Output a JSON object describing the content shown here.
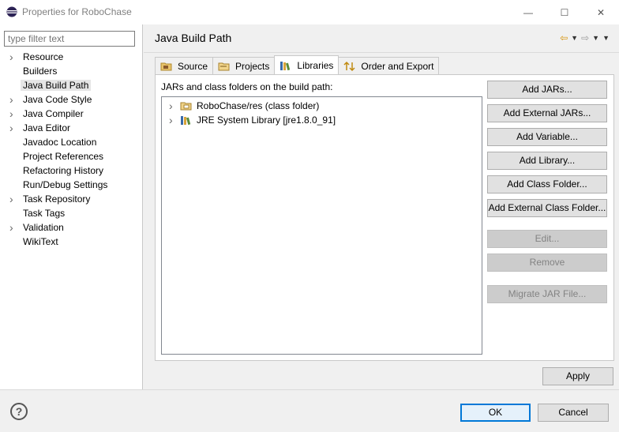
{
  "window": {
    "title": "Properties for RoboChase",
    "minimize_glyph": "—",
    "maximize_glyph": "☐",
    "close_glyph": "✕"
  },
  "sidebar": {
    "filter_placeholder": "type filter text",
    "items": [
      {
        "label": "Resource",
        "expandable": true
      },
      {
        "label": "Builders",
        "expandable": false
      },
      {
        "label": "Java Build Path",
        "expandable": false,
        "selected": true
      },
      {
        "label": "Java Code Style",
        "expandable": true
      },
      {
        "label": "Java Compiler",
        "expandable": true
      },
      {
        "label": "Java Editor",
        "expandable": true
      },
      {
        "label": "Javadoc Location",
        "expandable": false
      },
      {
        "label": "Project References",
        "expandable": false
      },
      {
        "label": "Refactoring History",
        "expandable": false
      },
      {
        "label": "Run/Debug Settings",
        "expandable": false
      },
      {
        "label": "Task Repository",
        "expandable": true
      },
      {
        "label": "Task Tags",
        "expandable": false
      },
      {
        "label": "Validation",
        "expandable": true
      },
      {
        "label": "WikiText",
        "expandable": false
      }
    ]
  },
  "page": {
    "title": "Java Build Path",
    "tabs": [
      {
        "label": "Source",
        "icon": "source-folder-icon"
      },
      {
        "label": "Projects",
        "icon": "projects-icon"
      },
      {
        "label": "Libraries",
        "icon": "libraries-icon",
        "active": true
      },
      {
        "label": "Order and Export",
        "icon": "order-export-icon"
      }
    ],
    "description": "JARs and class folders on the build path:",
    "tree": [
      {
        "label": "RoboChase/res (class folder)",
        "icon": "class-folder-icon"
      },
      {
        "label": "JRE System Library [jre1.8.0_91]",
        "icon": "library-icon"
      }
    ],
    "buttons": {
      "add_jars": "Add JARs...",
      "add_external_jars": "Add External JARs...",
      "add_variable": "Add Variable...",
      "add_library": "Add Library...",
      "add_class_folder": "Add Class Folder...",
      "add_external_class_folder": "Add External Class Folder...",
      "edit": "Edit...",
      "remove": "Remove",
      "migrate_jar": "Migrate JAR File..."
    },
    "apply": "Apply"
  },
  "footer": {
    "help": "?",
    "ok": "OK",
    "cancel": "Cancel"
  },
  "colors": {
    "accent": "#0078d7",
    "nav_arrow": "#d69000"
  }
}
